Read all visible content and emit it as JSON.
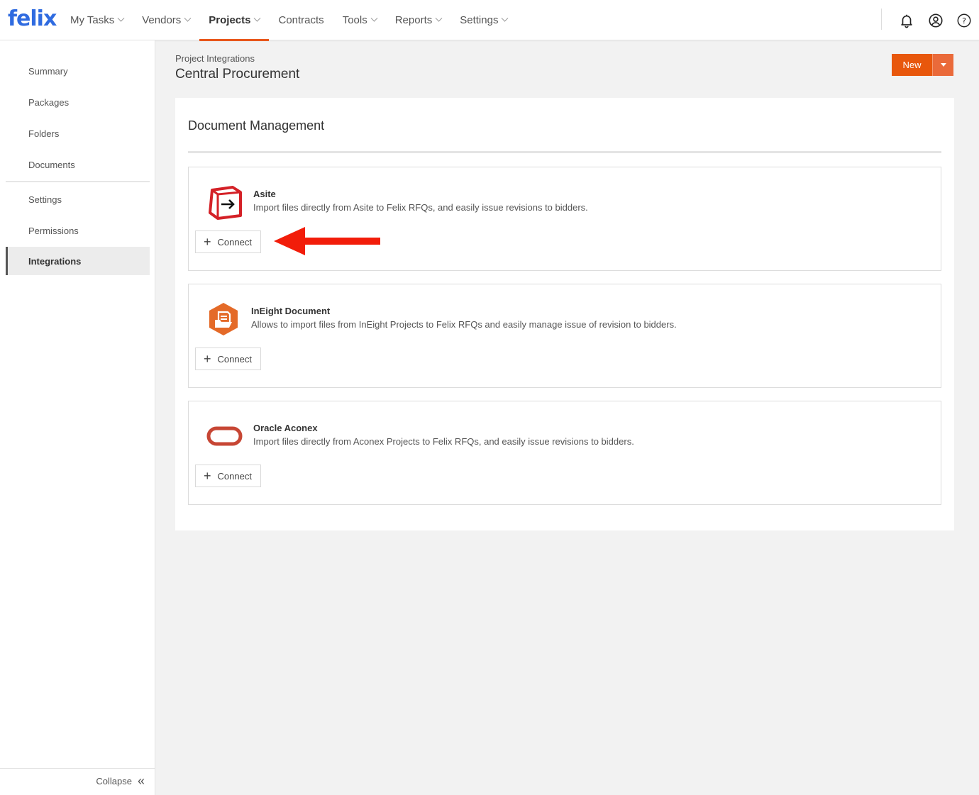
{
  "app": {
    "logo": "felix"
  },
  "nav": {
    "items": [
      {
        "label": "My Tasks",
        "dropdown": true
      },
      {
        "label": "Vendors",
        "dropdown": true
      },
      {
        "label": "Projects",
        "dropdown": true,
        "active": true
      },
      {
        "label": "Contracts",
        "dropdown": false
      },
      {
        "label": "Tools",
        "dropdown": true
      },
      {
        "label": "Reports",
        "dropdown": true
      },
      {
        "label": "Settings",
        "dropdown": true
      }
    ],
    "icons": [
      "bell-icon",
      "user-circle-icon",
      "help-icon"
    ]
  },
  "sidebar": {
    "items": [
      {
        "label": "Summary"
      },
      {
        "label": "Packages"
      },
      {
        "label": "Folders"
      },
      {
        "label": "Documents"
      },
      {
        "label": "Settings"
      },
      {
        "label": "Permissions"
      },
      {
        "label": "Integrations",
        "active": true
      }
    ],
    "collapse_label": "Collapse",
    "collapse_glyph": "«"
  },
  "header": {
    "breadcrumb": "Project Integrations",
    "title": "Central Procurement",
    "new_label": "New"
  },
  "section": {
    "title": "Document Management",
    "integrations": [
      {
        "name": "Asite",
        "description": "Import files directly from Asite to Felix RFQs, and easily issue revisions to bidders.",
        "connect_label": "Connect",
        "icon": "asite-logo-icon"
      },
      {
        "name": "InEight Document",
        "description": "Allows to import files from InEight Projects to Felix RFQs and easily manage issue of revision to bidders.",
        "connect_label": "Connect",
        "icon": "ineight-logo-icon"
      },
      {
        "name": "Oracle Aconex",
        "description": "Import files directly from Aconex Projects to Felix RFQs, and easily issue revisions to bidders.",
        "connect_label": "Connect",
        "icon": "oracle-logo-icon"
      }
    ]
  },
  "colors": {
    "brand": "#2f6be0",
    "accent": "#e8570c",
    "annotation_arrow": "#f21d0a"
  }
}
